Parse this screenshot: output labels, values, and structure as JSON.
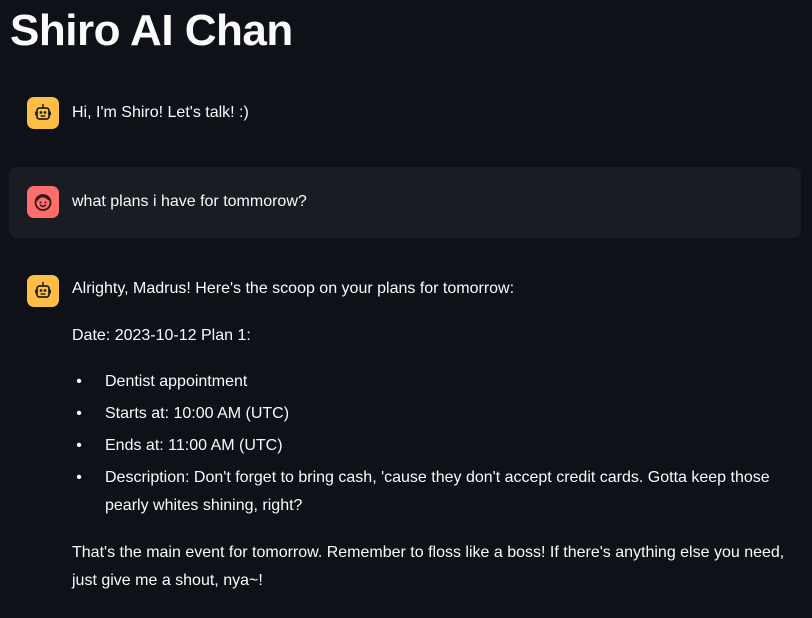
{
  "app": {
    "title": "Shiro AI Chan"
  },
  "icons": {
    "bot": "robot-face-icon",
    "user": "smiling-face-icon"
  },
  "colors": {
    "background": "#0e1117",
    "user_bubble": "#1a1c24",
    "bot_avatar": "#ffbd45",
    "user_avatar": "#ff6c6c"
  },
  "messages": [
    {
      "role": "assistant",
      "text": "Hi, I'm Shiro! Let's talk! :)"
    },
    {
      "role": "user",
      "text": "what plans i have for tommorow?"
    },
    {
      "role": "assistant",
      "intro": "Alrighty, Madrus! Here's the scoop on your plans for tomorrow:",
      "date_line": "Date: 2023-10-12 Plan 1:",
      "bullets": [
        "Dentist appointment",
        "Starts at: 10:00 AM (UTC)",
        "Ends at: 11:00 AM (UTC)",
        "Description: Don't forget to bring cash, 'cause they don't accept credit cards. Gotta keep those pearly whites shining, right?"
      ],
      "outro": "That's the main event for tomorrow. Remember to floss like a boss! If there's anything else you need, just give me a shout, nya~!"
    }
  ]
}
